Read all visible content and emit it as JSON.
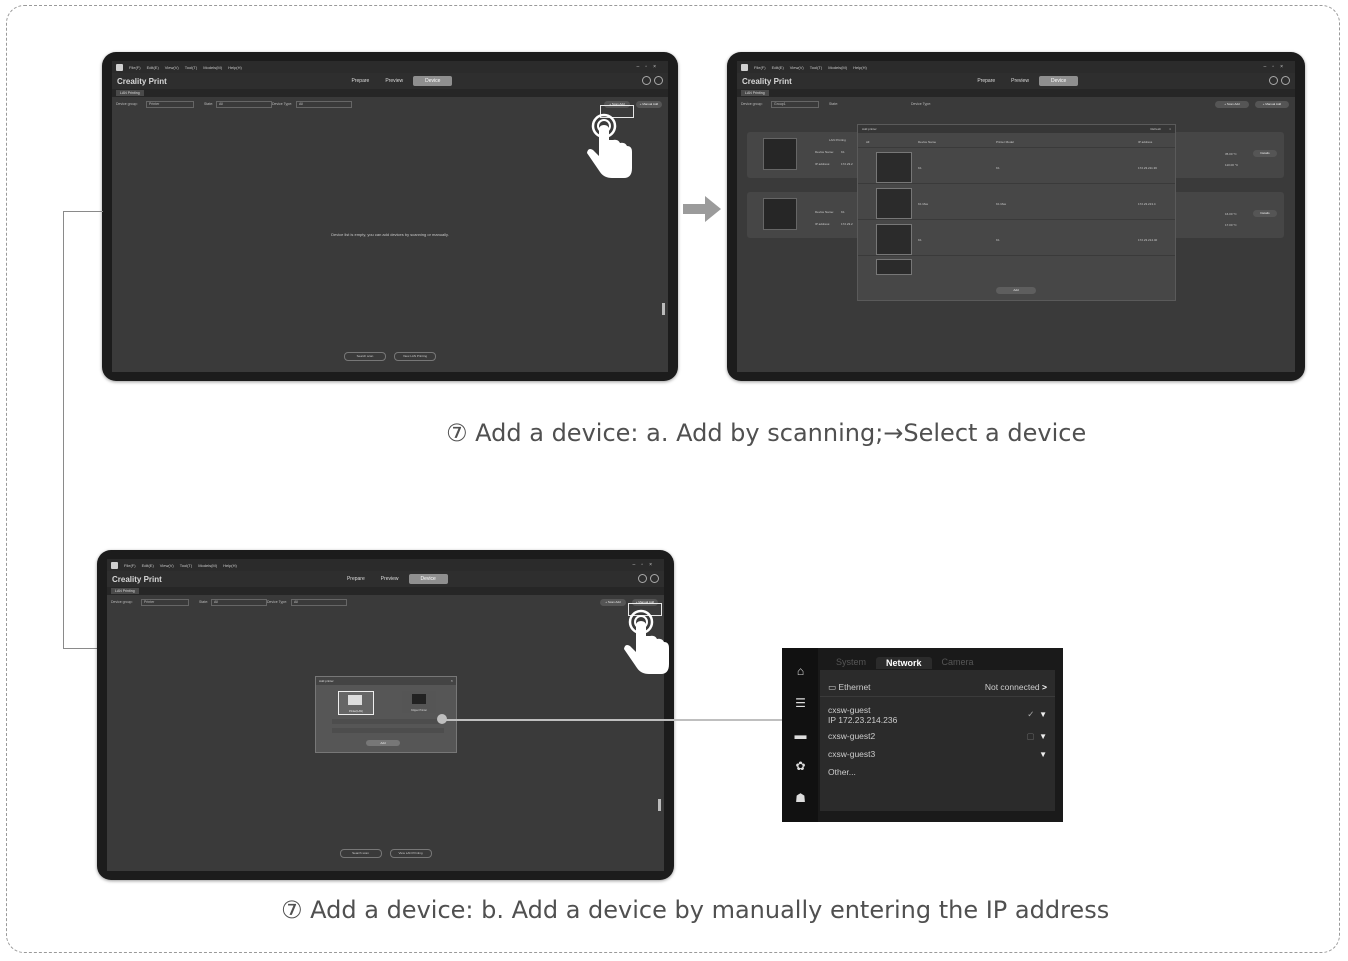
{
  "captions": {
    "scan": "⑦ Add a device: a. Add by scanning;→Select a device",
    "manual": "⑦ Add a device: b. Add a device by manually entering the IP address"
  },
  "app": {
    "title": "Creality Print",
    "menu": [
      "File(F)",
      "Edit(E)",
      "View(V)",
      "Tool(T)",
      "Models(M)",
      "Help(H)"
    ],
    "modes": [
      "Prepare",
      "Preview",
      "Device"
    ],
    "active_mode": "Device",
    "tab": "LAN Printing",
    "empty_message": "Device list is empty, you can add devices by scanning or manually.",
    "bottom_buttons": [
      "Search scan",
      "View LAN Printing"
    ],
    "scan_add": "+ Scan Add",
    "manual_add": "+ Manual Add",
    "filters": {
      "group_label": "Device group:",
      "group_value": "Printer",
      "state_label": "State:",
      "state_value": "All",
      "type_label": "Device Type:",
      "type_value": "All"
    }
  },
  "scan_dialog": {
    "title": "Add printer",
    "refresh": "Refresh",
    "columns": [
      "All",
      "Device Name",
      "Printer Model",
      "IP address"
    ],
    "rows": [
      {
        "name": "K1",
        "model": "K1",
        "ip": "172.23.211.36"
      },
      {
        "name": "K1 Max",
        "model": "K1 Max",
        "ip": "172.23.213.4"
      },
      {
        "name": "K1",
        "model": "K1",
        "ip": "172.23.214.40"
      }
    ],
    "add_button": "Add"
  },
  "device_list": {
    "group": "Group1",
    "details": "Details",
    "cards": [
      {
        "name_label": "Device Name:",
        "name": "K1",
        "ip_label": "IP address:",
        "ip": "172.23.2",
        "status": "LAN Printing",
        "temp1": "35.00 °C",
        "temp2": "110.00 °C"
      },
      {
        "name_label": "Device Name:",
        "name": "K1",
        "ip_label": "IP address:",
        "ip": "172.23.2",
        "status": "",
        "temp1": "16.00 °C",
        "temp2": "17.00 °C"
      }
    ]
  },
  "manual_dialog": {
    "title": "Add printer",
    "options": [
      "Printer(LAN)",
      "Klipper Printer"
    ],
    "add_button": "Add"
  },
  "network_panel": {
    "tabs": [
      "System",
      "Network",
      "Camera"
    ],
    "active_tab": "Network",
    "ethernet_label": "Ethernet",
    "ethernet_status": "Not connected",
    "networks": [
      {
        "ssid": "cxsw-guest",
        "ip": "IP 172.23.214.236",
        "connected": true,
        "locked": false
      },
      {
        "ssid": "cxsw-guest2",
        "ip": "",
        "connected": false,
        "locked": true
      },
      {
        "ssid": "cxsw-guest3",
        "ip": "",
        "connected": false,
        "locked": false
      }
    ],
    "other_label": "Other...",
    "side_icons": [
      "home-icon",
      "sliders-icon",
      "folder-icon",
      "gear-icon",
      "robot-icon"
    ]
  },
  "colors": {
    "bezel": "#1c1c1c",
    "screen": "#3a3a3a",
    "active_mode": "#8f8f8f",
    "caption": "#505050",
    "border": "#9a9a9a"
  }
}
